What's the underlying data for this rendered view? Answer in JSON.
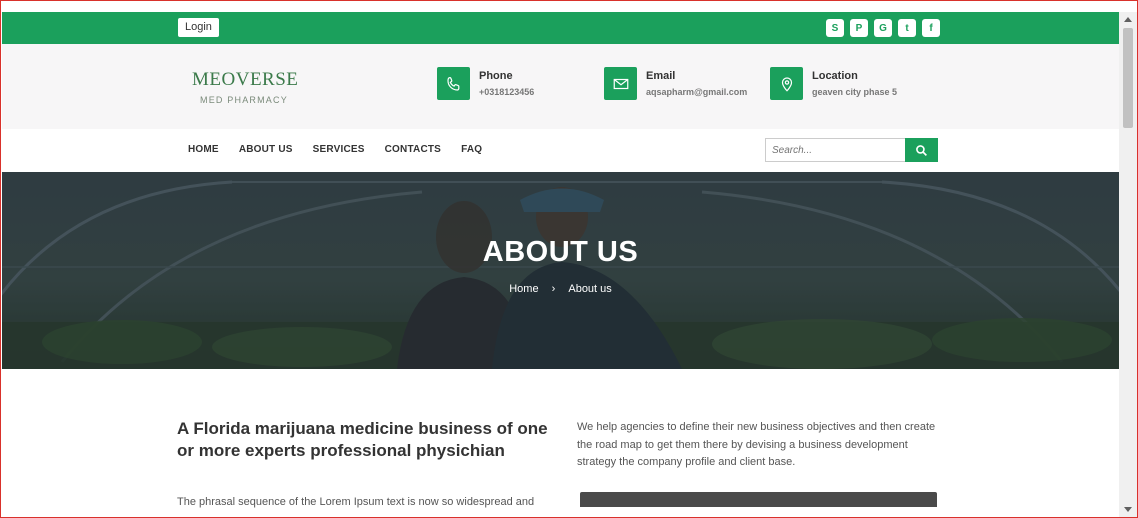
{
  "topbar": {
    "login_label": "Login",
    "social": [
      {
        "icon": "skype-icon",
        "glyph": "S"
      },
      {
        "icon": "pinterest-icon",
        "glyph": "P"
      },
      {
        "icon": "google-icon",
        "glyph": "G"
      },
      {
        "icon": "twitter-icon",
        "glyph": "t"
      },
      {
        "icon": "facebook-icon",
        "glyph": "f"
      }
    ]
  },
  "header": {
    "logo_name": "MEOVERSE",
    "logo_sub": "MED PHARMACY",
    "contacts": [
      {
        "icon": "phone-icon",
        "title": "Phone",
        "value": "+0318123456"
      },
      {
        "icon": "envelope-icon",
        "title": "Email",
        "value": "aqsapharm@gmail.com"
      },
      {
        "icon": "location-pin-icon",
        "title": "Location",
        "value": "geaven city phase 5"
      }
    ]
  },
  "nav": {
    "items": [
      "HOME",
      "ABOUT US",
      "SERVICES",
      "CONTACTS",
      "FAQ"
    ],
    "search_placeholder": "Search..."
  },
  "hero": {
    "title": "ABOUT US",
    "crumb_home": "Home",
    "crumb_sep": "›",
    "crumb_current": "About us"
  },
  "content": {
    "heading": "A Florida marijuana medicine business of one or more experts professional physichian",
    "intro": "We help agencies to define their new business objectives and then create the road map to get them there by devising a business development strategy the company profile and client base.",
    "paragraph": "The phrasal sequence of the Lorem Ipsum text is now so widespread and"
  },
  "colors": {
    "accent": "#1ba05c",
    "frame": "#d9312b"
  }
}
